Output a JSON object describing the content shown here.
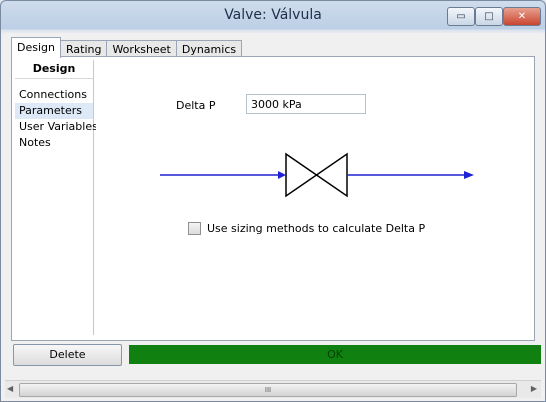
{
  "window": {
    "title": "Valve: Válvula",
    "minimize_glyph": "▭",
    "maximize_glyph": "□",
    "close_glyph": "✕"
  },
  "tabs": [
    {
      "label": "Design"
    },
    {
      "label": "Rating"
    },
    {
      "label": "Worksheet"
    },
    {
      "label": "Dynamics"
    }
  ],
  "sidebar": {
    "heading": "Design",
    "items": [
      {
        "label": "Connections"
      },
      {
        "label": "Parameters"
      },
      {
        "label": "User Variables"
      },
      {
        "label": "Notes"
      }
    ]
  },
  "parameters": {
    "delta_p_label": "Delta P",
    "delta_p_value": "3000 kPa",
    "sizing_label": "Use sizing methods to calculate Delta P",
    "sizing_checked": false
  },
  "footer": {
    "delete_label": "Delete",
    "status": "OK",
    "status_color": "#108010"
  },
  "scrollbar": {
    "grip": "III"
  },
  "colors": {
    "stream_arrow": "#1f22d4",
    "valve_stroke": "#000000"
  }
}
